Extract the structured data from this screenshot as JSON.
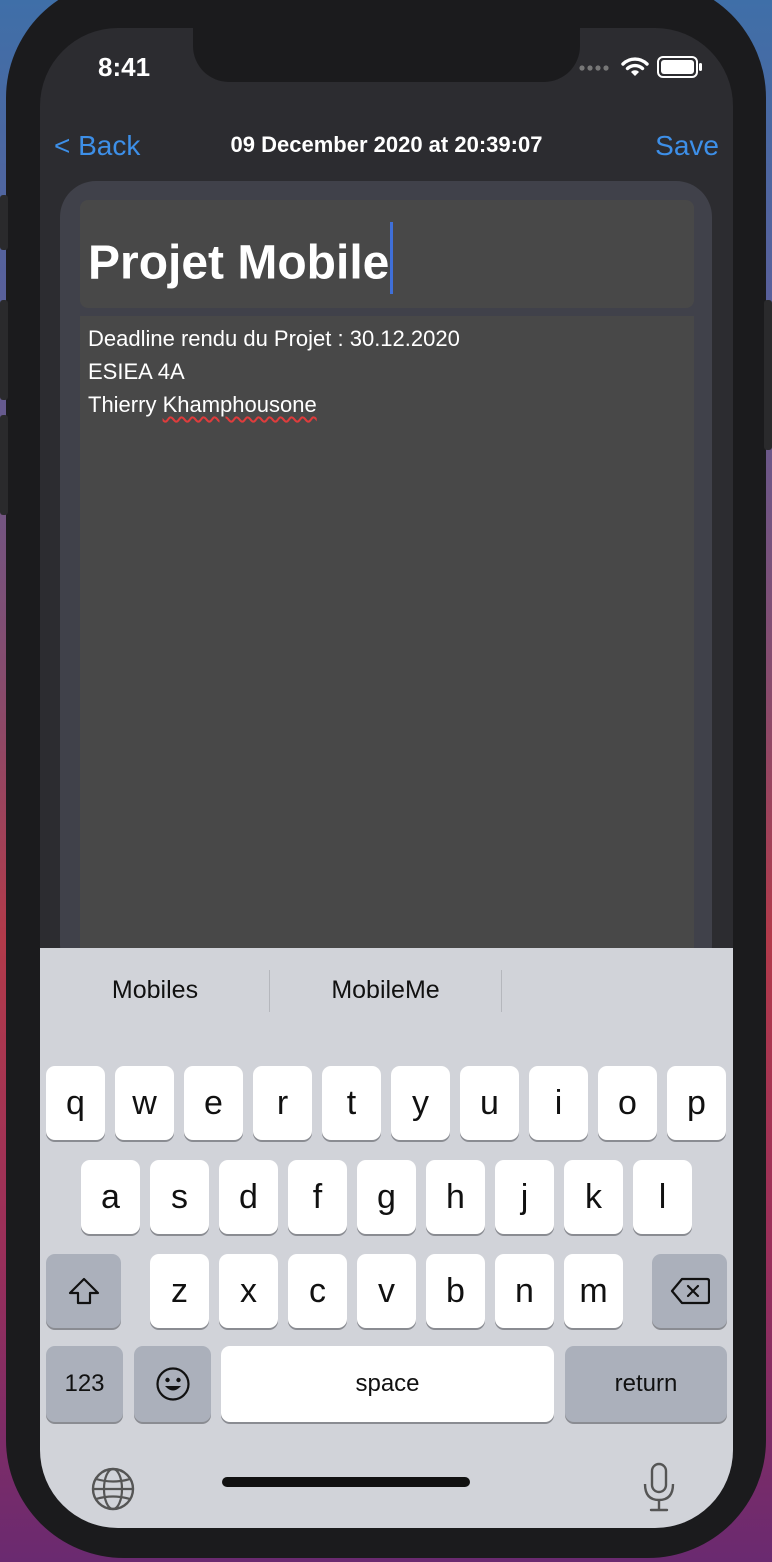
{
  "status_bar": {
    "time": "8:41"
  },
  "nav": {
    "back_label": "< Back",
    "title": "09 December 2020 at 20:39:07",
    "save_label": "Save"
  },
  "note": {
    "title": "Projet Mobile",
    "lines": [
      "Deadline rendu du Projet : 30.12.2020",
      "ESIEA 4A"
    ],
    "line3_first": "Thierry",
    "line3_misspelled": "Khamphousone"
  },
  "keyboard": {
    "suggestions": [
      "Mobiles",
      "MobileMe"
    ],
    "row1": [
      "q",
      "w",
      "e",
      "r",
      "t",
      "y",
      "u",
      "i",
      "o",
      "p"
    ],
    "row2": [
      "a",
      "s",
      "d",
      "f",
      "g",
      "h",
      "j",
      "k",
      "l"
    ],
    "row3": [
      "z",
      "x",
      "c",
      "v",
      "b",
      "n",
      "m"
    ],
    "numbers_label": "123",
    "space_label": "space",
    "return_label": "return"
  },
  "colors": {
    "accent": "#3d8fe8",
    "caret": "#3f6fd8"
  }
}
